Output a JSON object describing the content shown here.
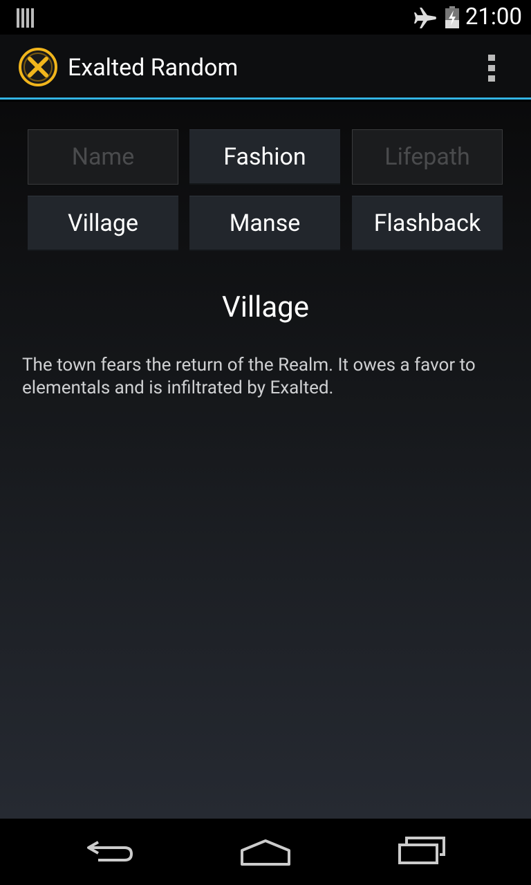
{
  "status_bar": {
    "time": "21:00",
    "icons": [
      "signal-bars-icon",
      "airplane-mode-icon",
      "battery-charging-icon"
    ]
  },
  "action_bar": {
    "title": "Exalted Random",
    "icons": [
      "app-logo-icon",
      "overflow-menu-icon"
    ],
    "accent_color": "#33b5e5"
  },
  "buttons": [
    {
      "label": "Name",
      "enabled": false
    },
    {
      "label": "Fashion",
      "enabled": true
    },
    {
      "label": "Lifepath",
      "enabled": false
    },
    {
      "label": "Village",
      "enabled": true
    },
    {
      "label": "Manse",
      "enabled": true
    },
    {
      "label": "Flashback",
      "enabled": true
    }
  ],
  "result": {
    "title": "Village",
    "text": "The town fears the return of the Realm. It owes a favor to elementals and is infiltrated by Exalted."
  },
  "nav_bar": {
    "icons": [
      "back-icon",
      "home-icon",
      "recent-apps-icon"
    ]
  }
}
